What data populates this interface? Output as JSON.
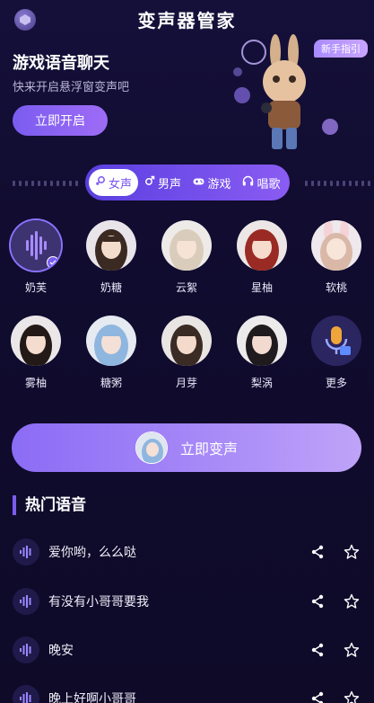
{
  "header": {
    "title": "变声器管家",
    "app_icon": "app-logo-icon"
  },
  "banner": {
    "title": "游戏语音聊天",
    "subtitle": "快来开启悬浮窗变声吧",
    "button": "立即开启",
    "guide_badge": "新手指引"
  },
  "tabs": [
    {
      "label": "女声",
      "icon": "female-icon",
      "active": true
    },
    {
      "label": "男声",
      "icon": "male-icon",
      "active": false
    },
    {
      "label": "游戏",
      "icon": "gamepad-icon",
      "active": false
    },
    {
      "label": "唱歌",
      "icon": "headphones-icon",
      "active": false
    }
  ],
  "voices": [
    {
      "name": "奶芙",
      "selected": true
    },
    {
      "name": "奶糖"
    },
    {
      "name": "云絮"
    },
    {
      "name": "星柚"
    },
    {
      "name": "软桃"
    },
    {
      "name": "雾柚"
    },
    {
      "name": "糖粥"
    },
    {
      "name": "月芽"
    },
    {
      "name": "梨涡"
    },
    {
      "name": "更多"
    }
  ],
  "action": {
    "label": "立即变声"
  },
  "hot": {
    "title": "热门语音",
    "items": [
      "爱你哟，么么哒",
      "有没有小哥哥要我",
      "晚安",
      "晚上好啊小哥哥"
    ]
  },
  "colors": {
    "accent": "#7b5cf0",
    "background": "#0f0b2a"
  }
}
